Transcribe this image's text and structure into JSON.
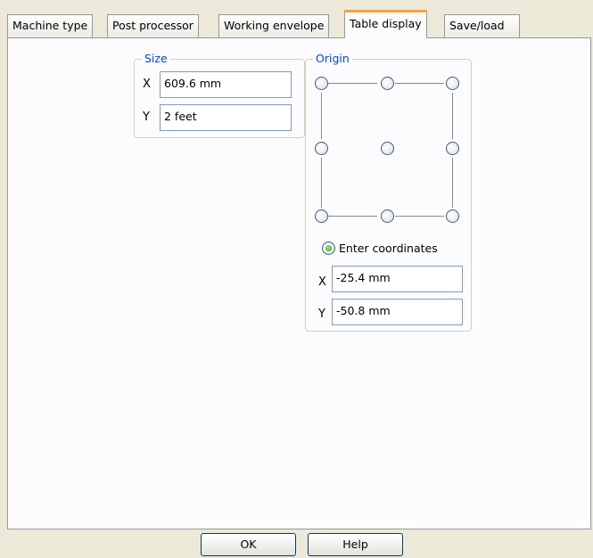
{
  "tabs": [
    {
      "label": "Machine type"
    },
    {
      "label": "Post processor"
    },
    {
      "label": "Working envelope"
    },
    {
      "label": "Table display",
      "active": true
    },
    {
      "label": "Save/load"
    }
  ],
  "size_group": {
    "legend": "Size",
    "x_label": "X",
    "x_value": "609.6 mm",
    "y_label": "Y",
    "y_value": "2 feet"
  },
  "origin_group": {
    "legend": "Origin",
    "enter_coordinates_label": "Enter coordinates",
    "enter_coordinates_selected": true,
    "x_label": "X",
    "x_value": "-25.4 mm",
    "y_label": "Y",
    "y_value": "-50.8 mm"
  },
  "buttons": {
    "ok": "OK",
    "help": "Help"
  },
  "colors": {
    "active_tab_accent": "#f7a23a",
    "group_legend": "#0046d5",
    "window_background": "#ece9d8"
  }
}
